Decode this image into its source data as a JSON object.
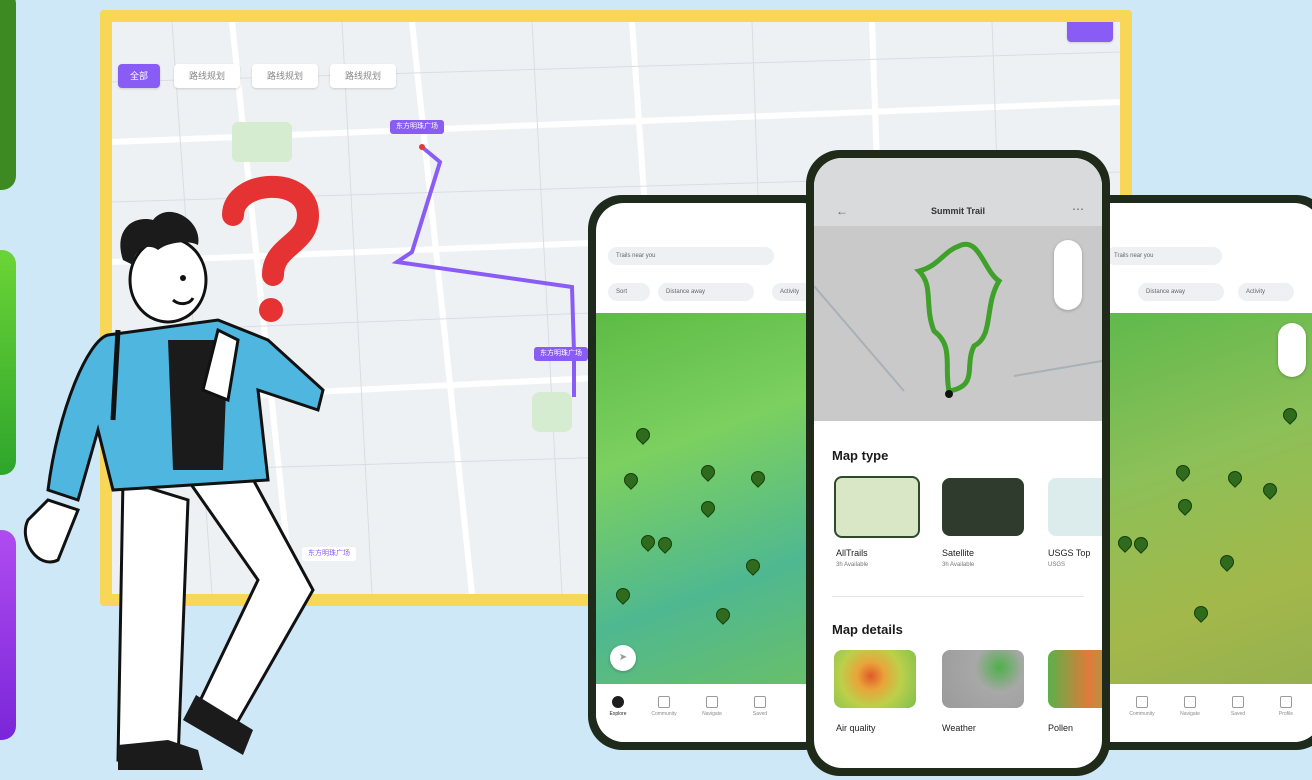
{
  "map_panel": {
    "filter_chips": [
      "全部",
      "路线规划",
      "路线规划",
      "路线规划"
    ],
    "location_labels": [
      "东方明珠广场",
      "东方明珠广场",
      "东方明珠广场"
    ]
  },
  "center_phone": {
    "title": "Summit Trail",
    "back_icon": "arrow-left-icon",
    "more_icon": "ellipsis-icon",
    "map_type_heading": "Map type",
    "map_types": [
      {
        "label": "AllTrails",
        "sub": "3h Available"
      },
      {
        "label": "Satellite",
        "sub": "3h Available"
      },
      {
        "label": "USGS Top",
        "sub": "USGS"
      }
    ],
    "map_details_heading": "Map details",
    "map_details": [
      {
        "label": "Air quality"
      },
      {
        "label": "Weather"
      },
      {
        "label": "Pollen"
      }
    ]
  },
  "left_phone": {
    "search_placeholder": "Trails near you",
    "filters": [
      "Sort",
      "Distance away",
      "Activity"
    ],
    "tabs": [
      "Explore",
      "Community",
      "Navigate",
      "Saved"
    ]
  },
  "right_phone": {
    "search_placeholder": "Trails near you",
    "filters": [
      "Distance away",
      "Activity"
    ],
    "tabs": [
      "Community",
      "Navigate",
      "Saved",
      "Profile"
    ]
  },
  "colors": {
    "background": "#cfe8f8",
    "map_frame": "#f7d658",
    "route": "#8a5cf6",
    "trail_green": "#3fa02a"
  }
}
